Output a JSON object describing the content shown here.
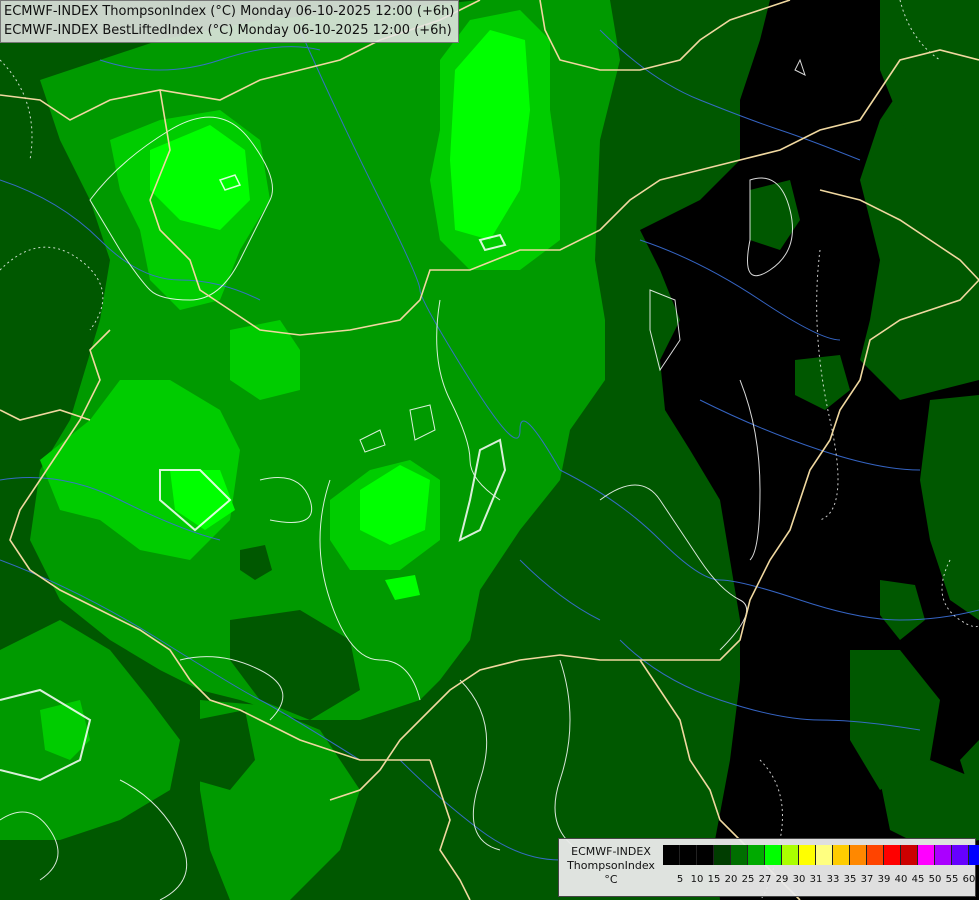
{
  "header": {
    "line1": "ECMWF-INDEX ThompsonIndex (°C) Monday 06-10-2025 12:00 (+6h)",
    "line2": "ECMWF-INDEX BestLiftedIndex (°C) Monday 06-10-2025 12:00 (+6h)"
  },
  "legend": {
    "title_line1": "ECMWF-INDEX",
    "title_line2": "ThompsonIndex",
    "title_line3": "°C",
    "ticks": [
      "5",
      "10",
      "15",
      "20",
      "25",
      "27",
      "29",
      "30",
      "31",
      "33",
      "35",
      "37",
      "39",
      "40",
      "45",
      "50",
      "55",
      "60"
    ],
    "colors": [
      "#000000",
      "#000000",
      "#000000",
      "#003d00",
      "#006e00",
      "#00aa00",
      "#00ff00",
      "#aaff00",
      "#ffff00",
      "#ffff80",
      "#ffcc00",
      "#ff8800",
      "#ff4400",
      "#ff0000",
      "#cc0000",
      "#ff00ff",
      "#aa00ff",
      "#6600ff",
      "#0000ff"
    ]
  },
  "map_colors": {
    "black": "#000000",
    "dark_green": "#005800",
    "mid_green": "#009a00",
    "light_green": "#00cc00",
    "bright_green": "#00ff00",
    "border": "#f0d8a0",
    "river": "#3b6fd8",
    "contour": "#ffffff"
  }
}
